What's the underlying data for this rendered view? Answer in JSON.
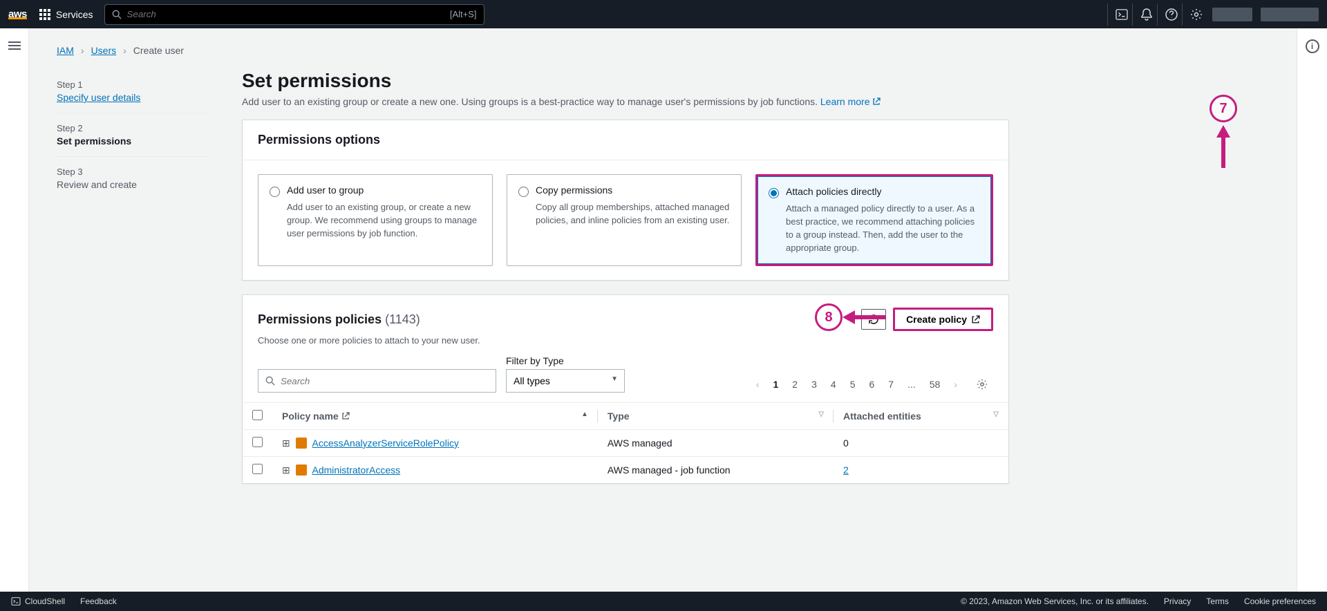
{
  "topbar": {
    "services_label": "Services",
    "search_placeholder": "Search",
    "search_hint": "[Alt+S]"
  },
  "breadcrumbs": {
    "root": "IAM",
    "users": "Users",
    "current": "Create user"
  },
  "steps": {
    "s1_num": "Step 1",
    "s1_title": "Specify user details",
    "s2_num": "Step 2",
    "s2_title": "Set permissions",
    "s3_num": "Step 3",
    "s3_title": "Review and create"
  },
  "heading": {
    "title": "Set permissions",
    "subtitle": "Add user to an existing group or create a new one. Using groups is a best-practice way to manage user's permissions by job functions. ",
    "learn_more": "Learn more"
  },
  "perm_options": {
    "panel_title": "Permissions options",
    "opt1_title": "Add user to group",
    "opt1_desc": "Add user to an existing group, or create a new group. We recommend using groups to manage user permissions by job function.",
    "opt2_title": "Copy permissions",
    "opt2_desc": "Copy all group memberships, attached managed policies, and inline policies from an existing user.",
    "opt3_title": "Attach policies directly",
    "opt3_desc": "Attach a managed policy directly to a user. As a best practice, we recommend attaching policies to a group instead. Then, add the user to the appropriate group."
  },
  "policies": {
    "title": "Permissions policies",
    "count": "(1143)",
    "sub": "Choose one or more policies to attach to your new user.",
    "create_btn": "Create policy",
    "filter_label": "Filter by Type",
    "filter_value": "All types",
    "search_placeholder": "Search",
    "col_policy": "Policy name",
    "col_type": "Type",
    "col_attached": "Attached entities",
    "rows": [
      {
        "name": "AccessAnalyzerServiceRolePolicy",
        "type": "AWS managed",
        "attached": "0"
      },
      {
        "name": "AdministratorAccess",
        "type": "AWS managed - job function",
        "attached": "2"
      }
    ],
    "pages": [
      "1",
      "2",
      "3",
      "4",
      "5",
      "6",
      "7",
      "...",
      "58"
    ]
  },
  "footer": {
    "cloudshell": "CloudShell",
    "feedback": "Feedback",
    "copyright": "© 2023, Amazon Web Services, Inc. or its affiliates.",
    "privacy": "Privacy",
    "terms": "Terms",
    "cookies": "Cookie preferences"
  },
  "annot": {
    "a7": "7",
    "a8": "8"
  }
}
